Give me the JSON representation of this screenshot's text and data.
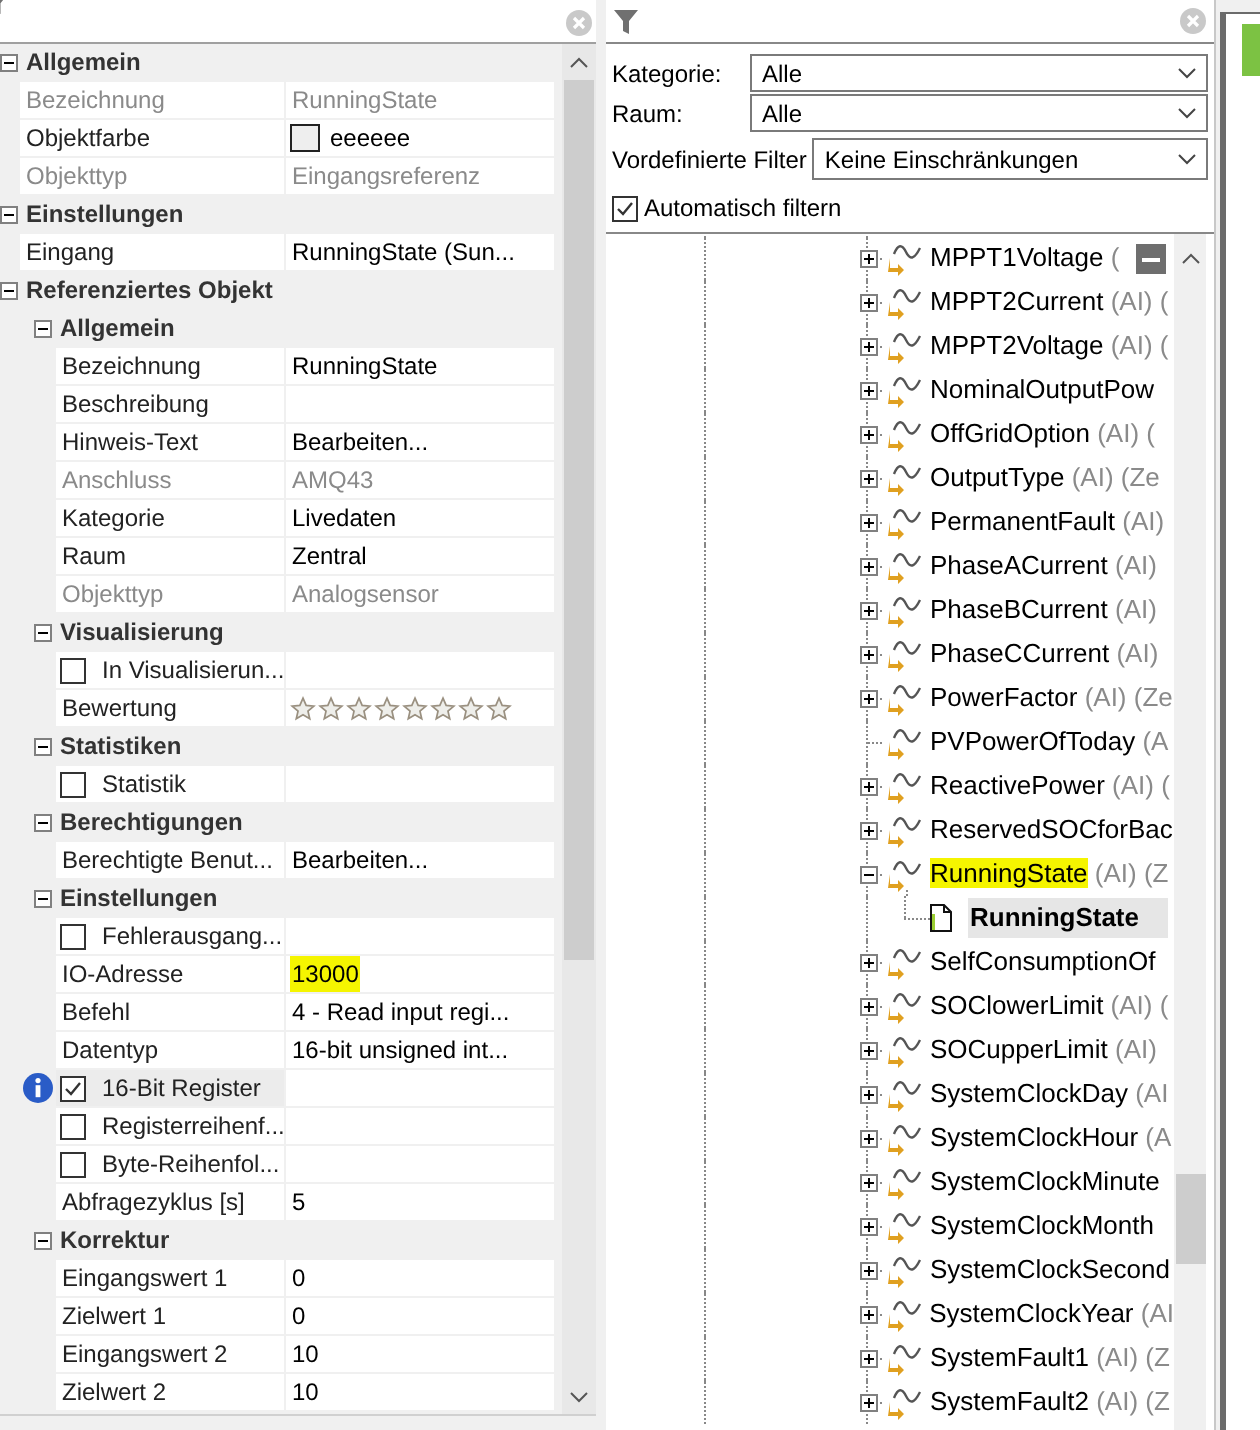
{
  "properties_panel": {
    "items": [
      {
        "kind": "category",
        "label": "Allgemein",
        "expanded": true,
        "children": [
          {
            "kind": "text",
            "label": "Bezeichnung",
            "value": "RunningState",
            "disabled": true,
            "selected": false
          },
          {
            "kind": "color",
            "label": "Objektfarbe",
            "value": "eeeeee",
            "disabled": false,
            "selected": false
          },
          {
            "kind": "text",
            "label": "Objekttyp",
            "value": "Eingangsreferenz",
            "disabled": true,
            "selected": false
          }
        ]
      },
      {
        "kind": "category",
        "label": "Einstellungen",
        "expanded": true,
        "children": [
          {
            "kind": "text",
            "label": "Eingang",
            "value": "RunningState (Sun...",
            "disabled": false,
            "selected": false
          }
        ]
      },
      {
        "kind": "category",
        "label": "Referenziertes Objekt",
        "expanded": true,
        "children": [
          {
            "kind": "category",
            "label": "Allgemein",
            "expanded": true,
            "children": [
              {
                "kind": "text",
                "label": "Bezeichnung",
                "value": "RunningState",
                "disabled": false,
                "selected": false
              },
              {
                "kind": "text",
                "label": "Beschreibung",
                "disabled": false,
                "selected": false
              },
              {
                "kind": "text",
                "label": "Hinweis-Text",
                "value": "Bearbeiten...",
                "disabled": false,
                "selected": false
              },
              {
                "kind": "text",
                "label": "Anschluss",
                "value": "AMQ43",
                "disabled": true,
                "selected": false
              },
              {
                "kind": "text",
                "label": "Kategorie",
                "value": "Livedaten",
                "disabled": false,
                "selected": false
              },
              {
                "kind": "text",
                "label": "Raum",
                "value": "Zentral",
                "disabled": false,
                "selected": false
              },
              {
                "kind": "text",
                "label": "Objekttyp",
                "value": "Analogsensor",
                "disabled": true,
                "selected": false
              }
            ]
          },
          {
            "kind": "category",
            "label": "Visualisierung",
            "expanded": true,
            "children": [
              {
                "kind": "checkbox",
                "label": "In Visualisierun...",
                "checked": false,
                "selected": false
              },
              {
                "kind": "stars",
                "label": "Bewertung",
                "stars": 0,
                "selected": false
              }
            ]
          },
          {
            "kind": "category",
            "label": "Statistiken",
            "expanded": true,
            "children": [
              {
                "kind": "checkbox",
                "label": "Statistik",
                "checked": false,
                "selected": false
              }
            ]
          },
          {
            "kind": "category",
            "label": "Berechtigungen",
            "expanded": true,
            "children": [
              {
                "kind": "text",
                "label": "Berechtigte Benut...",
                "value": "Bearbeiten...",
                "disabled": false,
                "selected": false
              }
            ]
          },
          {
            "kind": "category",
            "label": "Einstellungen",
            "expanded": true,
            "children": [
              {
                "kind": "checkbox",
                "label": "Fehlerausgang...",
                "checked": false,
                "selected": false
              },
              {
                "kind": "text",
                "label": "IO-Adresse",
                "value": "13000",
                "disabled": false,
                "selected": false,
                "highlighted": true
              },
              {
                "kind": "text",
                "label": "Befehl",
                "value": "4 - Read input regi...",
                "disabled": false,
                "selected": false
              },
              {
                "kind": "text",
                "label": "Datentyp",
                "value": "16-bit unsigned int...",
                "disabled": false,
                "selected": false
              },
              {
                "kind": "checkbox",
                "label": "16-Bit Register",
                "checked": true,
                "selected": true
              },
              {
                "kind": "checkbox",
                "label": "Registerreihenf...",
                "checked": false,
                "selected": false
              },
              {
                "kind": "checkbox",
                "label": "Byte-Reihenfol...",
                "checked": false,
                "selected": false
              },
              {
                "kind": "text",
                "label": "Abfragezyklus [s]",
                "value": "5",
                "disabled": false,
                "selected": false
              }
            ]
          },
          {
            "kind": "category",
            "label": "Korrektur",
            "expanded": true,
            "children": [
              {
                "kind": "text",
                "label": "Eingangswert 1",
                "value": "0",
                "disabled": false,
                "selected": false
              },
              {
                "kind": "text",
                "label": "Zielwert 1",
                "value": "0",
                "disabled": false,
                "selected": false
              },
              {
                "kind": "text",
                "label": "Eingangswert 2",
                "value": "10",
                "disabled": false,
                "selected": false
              },
              {
                "kind": "text",
                "label": "Zielwert 2",
                "value": "10",
                "disabled": false,
                "selected": false
              }
            ]
          }
        ]
      }
    ]
  },
  "object_panel": {
    "filters": [
      {
        "label": "Kategorie:",
        "value": "Alle"
      },
      {
        "label": "Raum:",
        "value": "Alle"
      },
      {
        "label": "Vordefinierte Filter",
        "value": "Keine Einschränkungen"
      }
    ],
    "auto_filter": {
      "label": "Automatisch filtern",
      "checked": true
    },
    "tree": [
      {
        "kind": "analog",
        "label": "MPPT1Voltage",
        "suffix": "(",
        "expandable": true,
        "expanded": false,
        "selected": false
      },
      {
        "kind": "analog",
        "label": "MPPT2Current",
        "suffix": "(AI) (",
        "expandable": true,
        "expanded": false,
        "selected": false
      },
      {
        "kind": "analog",
        "label": "MPPT2Voltage",
        "suffix": "(AI) (",
        "expandable": true,
        "expanded": false,
        "selected": false
      },
      {
        "kind": "analog",
        "label": "NominalOutputPow",
        "expandable": true,
        "expanded": false,
        "selected": false
      },
      {
        "kind": "analog",
        "label": "OffGridOption",
        "suffix": "(AI) (",
        "expandable": true,
        "expanded": false,
        "selected": false
      },
      {
        "kind": "analog",
        "label": "OutputType",
        "suffix": "(AI) (Ze",
        "expandable": true,
        "expanded": false,
        "selected": false
      },
      {
        "kind": "analog",
        "label": "PermanentFault",
        "suffix": "(AI)",
        "expandable": true,
        "expanded": false,
        "selected": false
      },
      {
        "kind": "analog",
        "label": "PhaseACurrent",
        "suffix": "(AI)",
        "expandable": true,
        "expanded": false,
        "selected": false
      },
      {
        "kind": "analog",
        "label": "PhaseBCurrent",
        "suffix": "(AI)",
        "expandable": true,
        "expanded": false,
        "selected": false
      },
      {
        "kind": "analog",
        "label": "PhaseCCurrent",
        "suffix": "(AI)",
        "expandable": true,
        "expanded": false,
        "selected": false
      },
      {
        "kind": "analog",
        "label": "PowerFactor",
        "suffix": "(AI) (Ze",
        "expandable": true,
        "expanded": false,
        "selected": false
      },
      {
        "kind": "analog",
        "label": "PVPowerOfToday",
        "suffix": "(A",
        "expandable": false,
        "expanded": false,
        "selected": false
      },
      {
        "kind": "analog",
        "label": "ReactivePower",
        "suffix": "(AI) (",
        "expandable": true,
        "expanded": false,
        "selected": false
      },
      {
        "kind": "analog",
        "label": "ReservedSOCforBac",
        "expandable": true,
        "expanded": false,
        "selected": false
      },
      {
        "kind": "analog",
        "label": "RunningState",
        "suffix": "(AI) (Z",
        "expandable": true,
        "expanded": true,
        "selected": false,
        "highlighted": true,
        "children": [
          {
            "kind": "document",
            "label": "RunningState",
            "selected": true
          }
        ]
      },
      {
        "kind": "analog",
        "label": "SelfConsumptionOf",
        "expandable": true,
        "expanded": false,
        "selected": false
      },
      {
        "kind": "analog",
        "label": "SOClowerLimit",
        "suffix": "(AI) (",
        "expandable": true,
        "expanded": false,
        "selected": false
      },
      {
        "kind": "analog",
        "label": "SOCupperLimit",
        "suffix": "(AI)",
        "expandable": true,
        "expanded": false,
        "selected": false
      },
      {
        "kind": "analog",
        "label": "SystemClockDay",
        "suffix": "(AI",
        "expandable": true,
        "expanded": false,
        "selected": false
      },
      {
        "kind": "analog",
        "label": "SystemClockHour",
        "suffix": "(A",
        "expandable": true,
        "expanded": false,
        "selected": false
      },
      {
        "kind": "analog",
        "label": "SystemClockMinute",
        "expandable": true,
        "expanded": false,
        "selected": false
      },
      {
        "kind": "analog",
        "label": "SystemClockMonth",
        "expandable": true,
        "expanded": false,
        "selected": false
      },
      {
        "kind": "analog",
        "label": "SystemClockSecond",
        "expandable": true,
        "expanded": false,
        "selected": false
      },
      {
        "kind": "analog",
        "label": "SystemClockYear",
        "suffix": "(AI",
        "expandable": true,
        "expanded": false,
        "selected": false
      },
      {
        "kind": "analog",
        "label": "SystemFault1",
        "suffix": "(AI) (Z",
        "expandable": true,
        "expanded": false,
        "selected": false
      },
      {
        "kind": "analog",
        "label": "SystemFault2",
        "suffix": "(AI) (Z",
        "expandable": true,
        "expanded": false,
        "selected": false
      }
    ]
  }
}
